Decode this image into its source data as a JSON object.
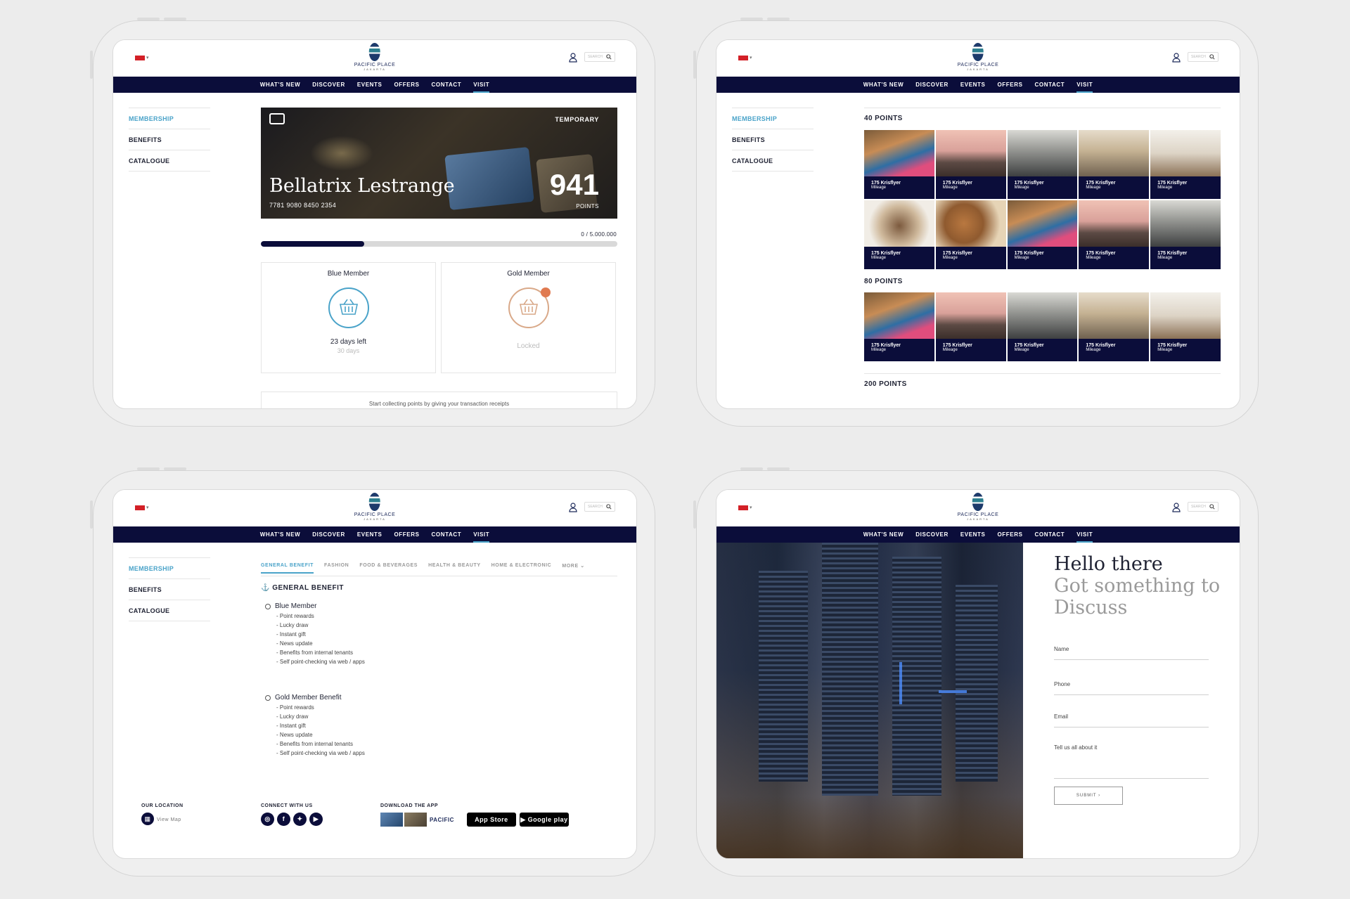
{
  "header": {
    "logo_text": "PACIFIC PLACE",
    "logo_sub": "JAKARTA",
    "search_placeholder": "SEARCH",
    "nav": [
      "WHAT'S NEW",
      "DISCOVER",
      "EVENTS",
      "OFFERS",
      "CONTACT",
      "VISIT"
    ],
    "active_nav": "VISIT"
  },
  "sidebar": {
    "items": [
      "MEMBERSHIP",
      "BENEFITS",
      "CATALOGUE"
    ],
    "active": "MEMBERSHIP"
  },
  "membership": {
    "card_status": "TEMPORARY",
    "card_name": "Bellatrix Lestrange",
    "card_number": "7781 9080 8450 2354",
    "points": "941",
    "points_label": "POINTS",
    "progress_text": "0 / 5.000.000",
    "progress_fraction": 0.29,
    "tiers": [
      {
        "title": "Blue Member",
        "status": "23 days left",
        "sub": "30 days",
        "color": "#4aa3c9"
      },
      {
        "title": "Gold Member",
        "status": "Locked",
        "sub": "",
        "color": "#d9a989"
      }
    ],
    "footer_note": "Start collecting points by giving your transaction receipts"
  },
  "catalogue": {
    "sections": [
      {
        "heading": "40 POINTS",
        "tiles": [
          {
            "title": "175 Krisflyer",
            "sub": "Mileage",
            "photo": "p1"
          },
          {
            "title": "175 Krisflyer",
            "sub": "Mileage",
            "photo": "p2"
          },
          {
            "title": "175 Krisflyer",
            "sub": "Mileage",
            "photo": "p3"
          },
          {
            "title": "175 Krisflyer",
            "sub": "Mileage",
            "photo": "p4"
          },
          {
            "title": "175 Krisflyer",
            "sub": "Mileage",
            "photo": "p5"
          },
          {
            "title": "175 Krisflyer",
            "sub": "Mileage",
            "photo": "p6"
          },
          {
            "title": "175 Krisflyer",
            "sub": "Mileage",
            "photo": "p7"
          },
          {
            "title": "175 Krisflyer",
            "sub": "Mileage",
            "photo": "p1"
          },
          {
            "title": "175 Krisflyer",
            "sub": "Mileage",
            "photo": "p2"
          },
          {
            "title": "175 Krisflyer",
            "sub": "Mileage",
            "photo": "p3"
          }
        ]
      },
      {
        "heading": "80 POINTS",
        "tiles": [
          {
            "title": "175 Krisflyer",
            "sub": "Mileage",
            "photo": "p1"
          },
          {
            "title": "175 Krisflyer",
            "sub": "Mileage",
            "photo": "p2"
          },
          {
            "title": "175 Krisflyer",
            "sub": "Mileage",
            "photo": "p3"
          },
          {
            "title": "175 Krisflyer",
            "sub": "Mileage",
            "photo": "p4"
          },
          {
            "title": "175 Krisflyer",
            "sub": "Mileage",
            "photo": "p5"
          }
        ]
      },
      {
        "heading": "200 POINTS",
        "tiles": []
      }
    ]
  },
  "benefits": {
    "tabs": [
      "GENERAL BENEFIT",
      "FASHION",
      "FOOD & BEVERAGES",
      "HEALTH & BEAUTY",
      "HOME & ELECTRONIC",
      "MORE"
    ],
    "active_tab": "GENERAL BENEFIT",
    "section_title": "GENERAL BENEFIT",
    "groups": [
      {
        "title": "Blue Member",
        "items": [
          "- Point rewards",
          "- Lucky draw",
          "- Instant gift",
          "- News update",
          "- Benefits from internal tenants",
          "- Self point-checking via web / apps"
        ]
      },
      {
        "title": "Gold Member Benefit",
        "items": [
          "- Point rewards",
          "- Lucky draw",
          "- Instant gift",
          "- News update",
          "- Benefits from internal tenants",
          "- Self point-checking via web / apps"
        ]
      }
    ]
  },
  "footer": {
    "location_heading": "OUR LOCATION",
    "view_map": "View Map",
    "connect_heading": "CONNECT WITH US",
    "social_icons": [
      "instagram-icon",
      "facebook-icon",
      "twitter-icon",
      "youtube-icon"
    ],
    "download_heading": "DOWNLOAD THE APP",
    "app_store": "App Store",
    "google_play": "Google play",
    "app_brand": "PACIFIC"
  },
  "contact": {
    "heading_line1": "Hello there",
    "heading_line2": "Got something to",
    "heading_line3": "Discuss",
    "fields": [
      "Name",
      "Phone",
      "Email",
      "Tell us all about it"
    ],
    "submit": "SUBMIT"
  }
}
